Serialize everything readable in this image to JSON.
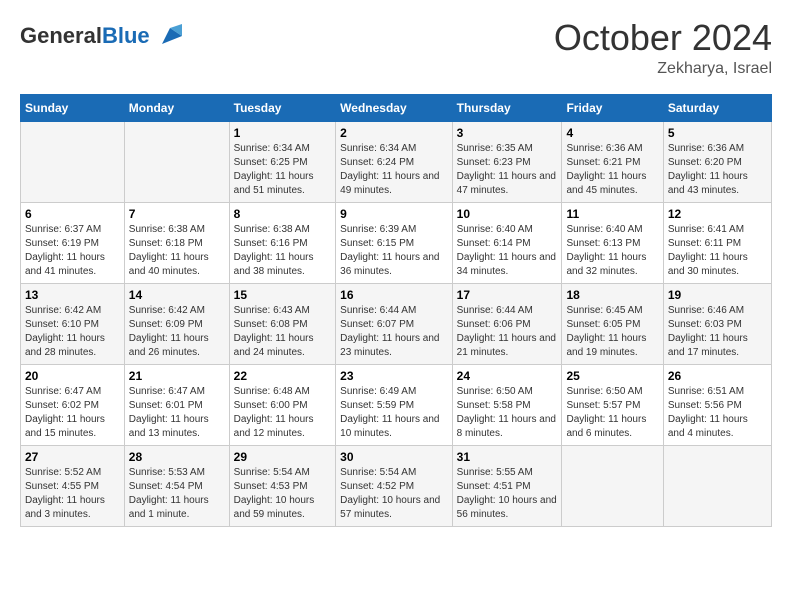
{
  "logo": {
    "text_general": "General",
    "text_blue": "Blue"
  },
  "header": {
    "month_title": "October 2024",
    "location": "Zekharya, Israel"
  },
  "weekdays": [
    "Sunday",
    "Monday",
    "Tuesday",
    "Wednesday",
    "Thursday",
    "Friday",
    "Saturday"
  ],
  "weeks": [
    [
      {
        "day": "",
        "sunrise": "",
        "sunset": "",
        "daylight": ""
      },
      {
        "day": "",
        "sunrise": "",
        "sunset": "",
        "daylight": ""
      },
      {
        "day": "1",
        "sunrise": "Sunrise: 6:34 AM",
        "sunset": "Sunset: 6:25 PM",
        "daylight": "Daylight: 11 hours and 51 minutes."
      },
      {
        "day": "2",
        "sunrise": "Sunrise: 6:34 AM",
        "sunset": "Sunset: 6:24 PM",
        "daylight": "Daylight: 11 hours and 49 minutes."
      },
      {
        "day": "3",
        "sunrise": "Sunrise: 6:35 AM",
        "sunset": "Sunset: 6:23 PM",
        "daylight": "Daylight: 11 hours and 47 minutes."
      },
      {
        "day": "4",
        "sunrise": "Sunrise: 6:36 AM",
        "sunset": "Sunset: 6:21 PM",
        "daylight": "Daylight: 11 hours and 45 minutes."
      },
      {
        "day": "5",
        "sunrise": "Sunrise: 6:36 AM",
        "sunset": "Sunset: 6:20 PM",
        "daylight": "Daylight: 11 hours and 43 minutes."
      }
    ],
    [
      {
        "day": "6",
        "sunrise": "Sunrise: 6:37 AM",
        "sunset": "Sunset: 6:19 PM",
        "daylight": "Daylight: 11 hours and 41 minutes."
      },
      {
        "day": "7",
        "sunrise": "Sunrise: 6:38 AM",
        "sunset": "Sunset: 6:18 PM",
        "daylight": "Daylight: 11 hours and 40 minutes."
      },
      {
        "day": "8",
        "sunrise": "Sunrise: 6:38 AM",
        "sunset": "Sunset: 6:16 PM",
        "daylight": "Daylight: 11 hours and 38 minutes."
      },
      {
        "day": "9",
        "sunrise": "Sunrise: 6:39 AM",
        "sunset": "Sunset: 6:15 PM",
        "daylight": "Daylight: 11 hours and 36 minutes."
      },
      {
        "day": "10",
        "sunrise": "Sunrise: 6:40 AM",
        "sunset": "Sunset: 6:14 PM",
        "daylight": "Daylight: 11 hours and 34 minutes."
      },
      {
        "day": "11",
        "sunrise": "Sunrise: 6:40 AM",
        "sunset": "Sunset: 6:13 PM",
        "daylight": "Daylight: 11 hours and 32 minutes."
      },
      {
        "day": "12",
        "sunrise": "Sunrise: 6:41 AM",
        "sunset": "Sunset: 6:11 PM",
        "daylight": "Daylight: 11 hours and 30 minutes."
      }
    ],
    [
      {
        "day": "13",
        "sunrise": "Sunrise: 6:42 AM",
        "sunset": "Sunset: 6:10 PM",
        "daylight": "Daylight: 11 hours and 28 minutes."
      },
      {
        "day": "14",
        "sunrise": "Sunrise: 6:42 AM",
        "sunset": "Sunset: 6:09 PM",
        "daylight": "Daylight: 11 hours and 26 minutes."
      },
      {
        "day": "15",
        "sunrise": "Sunrise: 6:43 AM",
        "sunset": "Sunset: 6:08 PM",
        "daylight": "Daylight: 11 hours and 24 minutes."
      },
      {
        "day": "16",
        "sunrise": "Sunrise: 6:44 AM",
        "sunset": "Sunset: 6:07 PM",
        "daylight": "Daylight: 11 hours and 23 minutes."
      },
      {
        "day": "17",
        "sunrise": "Sunrise: 6:44 AM",
        "sunset": "Sunset: 6:06 PM",
        "daylight": "Daylight: 11 hours and 21 minutes."
      },
      {
        "day": "18",
        "sunrise": "Sunrise: 6:45 AM",
        "sunset": "Sunset: 6:05 PM",
        "daylight": "Daylight: 11 hours and 19 minutes."
      },
      {
        "day": "19",
        "sunrise": "Sunrise: 6:46 AM",
        "sunset": "Sunset: 6:03 PM",
        "daylight": "Daylight: 11 hours and 17 minutes."
      }
    ],
    [
      {
        "day": "20",
        "sunrise": "Sunrise: 6:47 AM",
        "sunset": "Sunset: 6:02 PM",
        "daylight": "Daylight: 11 hours and 15 minutes."
      },
      {
        "day": "21",
        "sunrise": "Sunrise: 6:47 AM",
        "sunset": "Sunset: 6:01 PM",
        "daylight": "Daylight: 11 hours and 13 minutes."
      },
      {
        "day": "22",
        "sunrise": "Sunrise: 6:48 AM",
        "sunset": "Sunset: 6:00 PM",
        "daylight": "Daylight: 11 hours and 12 minutes."
      },
      {
        "day": "23",
        "sunrise": "Sunrise: 6:49 AM",
        "sunset": "Sunset: 5:59 PM",
        "daylight": "Daylight: 11 hours and 10 minutes."
      },
      {
        "day": "24",
        "sunrise": "Sunrise: 6:50 AM",
        "sunset": "Sunset: 5:58 PM",
        "daylight": "Daylight: 11 hours and 8 minutes."
      },
      {
        "day": "25",
        "sunrise": "Sunrise: 6:50 AM",
        "sunset": "Sunset: 5:57 PM",
        "daylight": "Daylight: 11 hours and 6 minutes."
      },
      {
        "day": "26",
        "sunrise": "Sunrise: 6:51 AM",
        "sunset": "Sunset: 5:56 PM",
        "daylight": "Daylight: 11 hours and 4 minutes."
      }
    ],
    [
      {
        "day": "27",
        "sunrise": "Sunrise: 5:52 AM",
        "sunset": "Sunset: 4:55 PM",
        "daylight": "Daylight: 11 hours and 3 minutes."
      },
      {
        "day": "28",
        "sunrise": "Sunrise: 5:53 AM",
        "sunset": "Sunset: 4:54 PM",
        "daylight": "Daylight: 11 hours and 1 minute."
      },
      {
        "day": "29",
        "sunrise": "Sunrise: 5:54 AM",
        "sunset": "Sunset: 4:53 PM",
        "daylight": "Daylight: 10 hours and 59 minutes."
      },
      {
        "day": "30",
        "sunrise": "Sunrise: 5:54 AM",
        "sunset": "Sunset: 4:52 PM",
        "daylight": "Daylight: 10 hours and 57 minutes."
      },
      {
        "day": "31",
        "sunrise": "Sunrise: 5:55 AM",
        "sunset": "Sunset: 4:51 PM",
        "daylight": "Daylight: 10 hours and 56 minutes."
      },
      {
        "day": "",
        "sunrise": "",
        "sunset": "",
        "daylight": ""
      },
      {
        "day": "",
        "sunrise": "",
        "sunset": "",
        "daylight": ""
      }
    ]
  ]
}
